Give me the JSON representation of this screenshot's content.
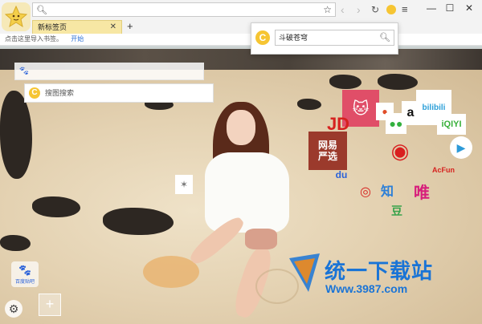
{
  "browser": {
    "address_value": "",
    "tab_title": "新标签页",
    "new_tab": "+",
    "import_prompt": "点击这里导入书签。",
    "import_link": "开始",
    "minimize": "—",
    "maximize": "☐",
    "close": "✕"
  },
  "popup": {
    "query": "斗破苍穹"
  },
  "page": {
    "baidu_search_placeholder": "",
    "sogou_search_placeholder": "搜图搜索",
    "bottom_icon_label": "百度贴吧"
  },
  "tiles": {
    "jd": "JD",
    "wangyi": "网易\n严选",
    "bilibili": "bilibili",
    "iqiyi": "iQIYI",
    "acfun": "AcFun",
    "zhi": "知",
    "wei": "唯",
    "dou": "豆",
    "a": "a"
  },
  "watermark": {
    "title": "统一下载站",
    "url": "Www.3987.com"
  },
  "colors": {
    "accent_yellow": "#f6c533",
    "tab_bg": "#f7e7a4",
    "link_blue": "#2a6fd6",
    "watermark_blue": "#1a74d6"
  }
}
